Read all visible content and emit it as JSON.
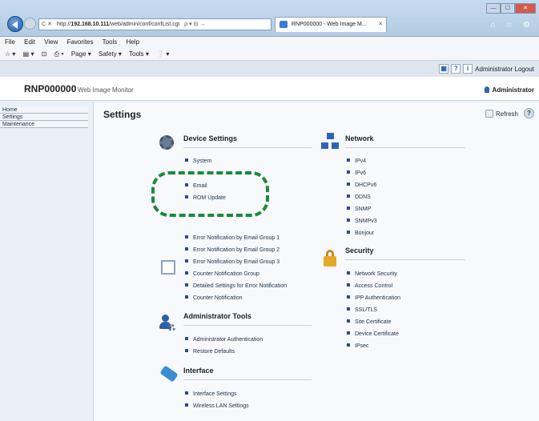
{
  "browser": {
    "url_prefix": "http://",
    "url_host": "192.168.10.111",
    "url_path": "/web/admin/conf/confList.cgi",
    "address_controls": "C ✕",
    "address_actions": "ρ ▾ ⊟ →",
    "tab_title": "RNP000000 - Web Image M...",
    "tab_close": "✕",
    "window_controls": [
      "—",
      "☐",
      "✕"
    ],
    "fav_icons": "⌂ ☆ ⚙"
  },
  "menubar": [
    "File",
    "Edit",
    "View",
    "Favorites",
    "Tools",
    "Help"
  ],
  "commandbar": [
    "☆ ▾",
    "▤ ▾",
    "⊡",
    "⎙ ▾",
    "Page ▾",
    "Safety ▾",
    "Tools ▾",
    "❔ ▾"
  ],
  "header": {
    "product_name": "RNP000000",
    "app_name": "Web Image Monitor",
    "top_buttons": [
      "▦",
      "?",
      "i"
    ],
    "logout_label": "Administrator Logout",
    "user_label": "Administrator"
  },
  "sidebar": {
    "items": [
      {
        "label": "Home"
      },
      {
        "label": "Settings"
      },
      {
        "label": "Maintenance"
      }
    ]
  },
  "main": {
    "title": "Settings",
    "refresh_label": "Refresh",
    "help_label": "?"
  },
  "sections": {
    "device": {
      "heading": "Device Settings",
      "links": [
        "System",
        "Email",
        "ROM Update"
      ]
    },
    "notifications": {
      "links": [
        "Error Notification by Email Group 1",
        "Error Notification by Email Group 2",
        "Error Notification by Email Group 3",
        "Counter Notification Group",
        "Detailed Settings for Error Notification",
        "Counter Notification"
      ]
    },
    "admin": {
      "heading": "Administrator Tools",
      "links": [
        "Administrator Authentication",
        "Restore Defaults"
      ]
    },
    "interface": {
      "heading": "Interface",
      "links": [
        "Interface Settings",
        "Wireless LAN Settings"
      ]
    },
    "network": {
      "heading": "Network",
      "links": [
        "IPv4",
        "IPv6",
        "DHCPv6",
        "DDNS",
        "SNMP",
        "SNMPv3",
        "Bonjour"
      ]
    },
    "security": {
      "heading": "Security",
      "links": [
        "Network Security",
        "Access Control",
        "IPP Authentication",
        "SSL/TLS",
        "Site Certificate",
        "Device Certificate",
        "IPsec"
      ]
    }
  },
  "colors": {
    "highlight": "#1c8a3b",
    "icon_blue": "#2c5ea3",
    "lock_gold": "#e5a92a"
  }
}
